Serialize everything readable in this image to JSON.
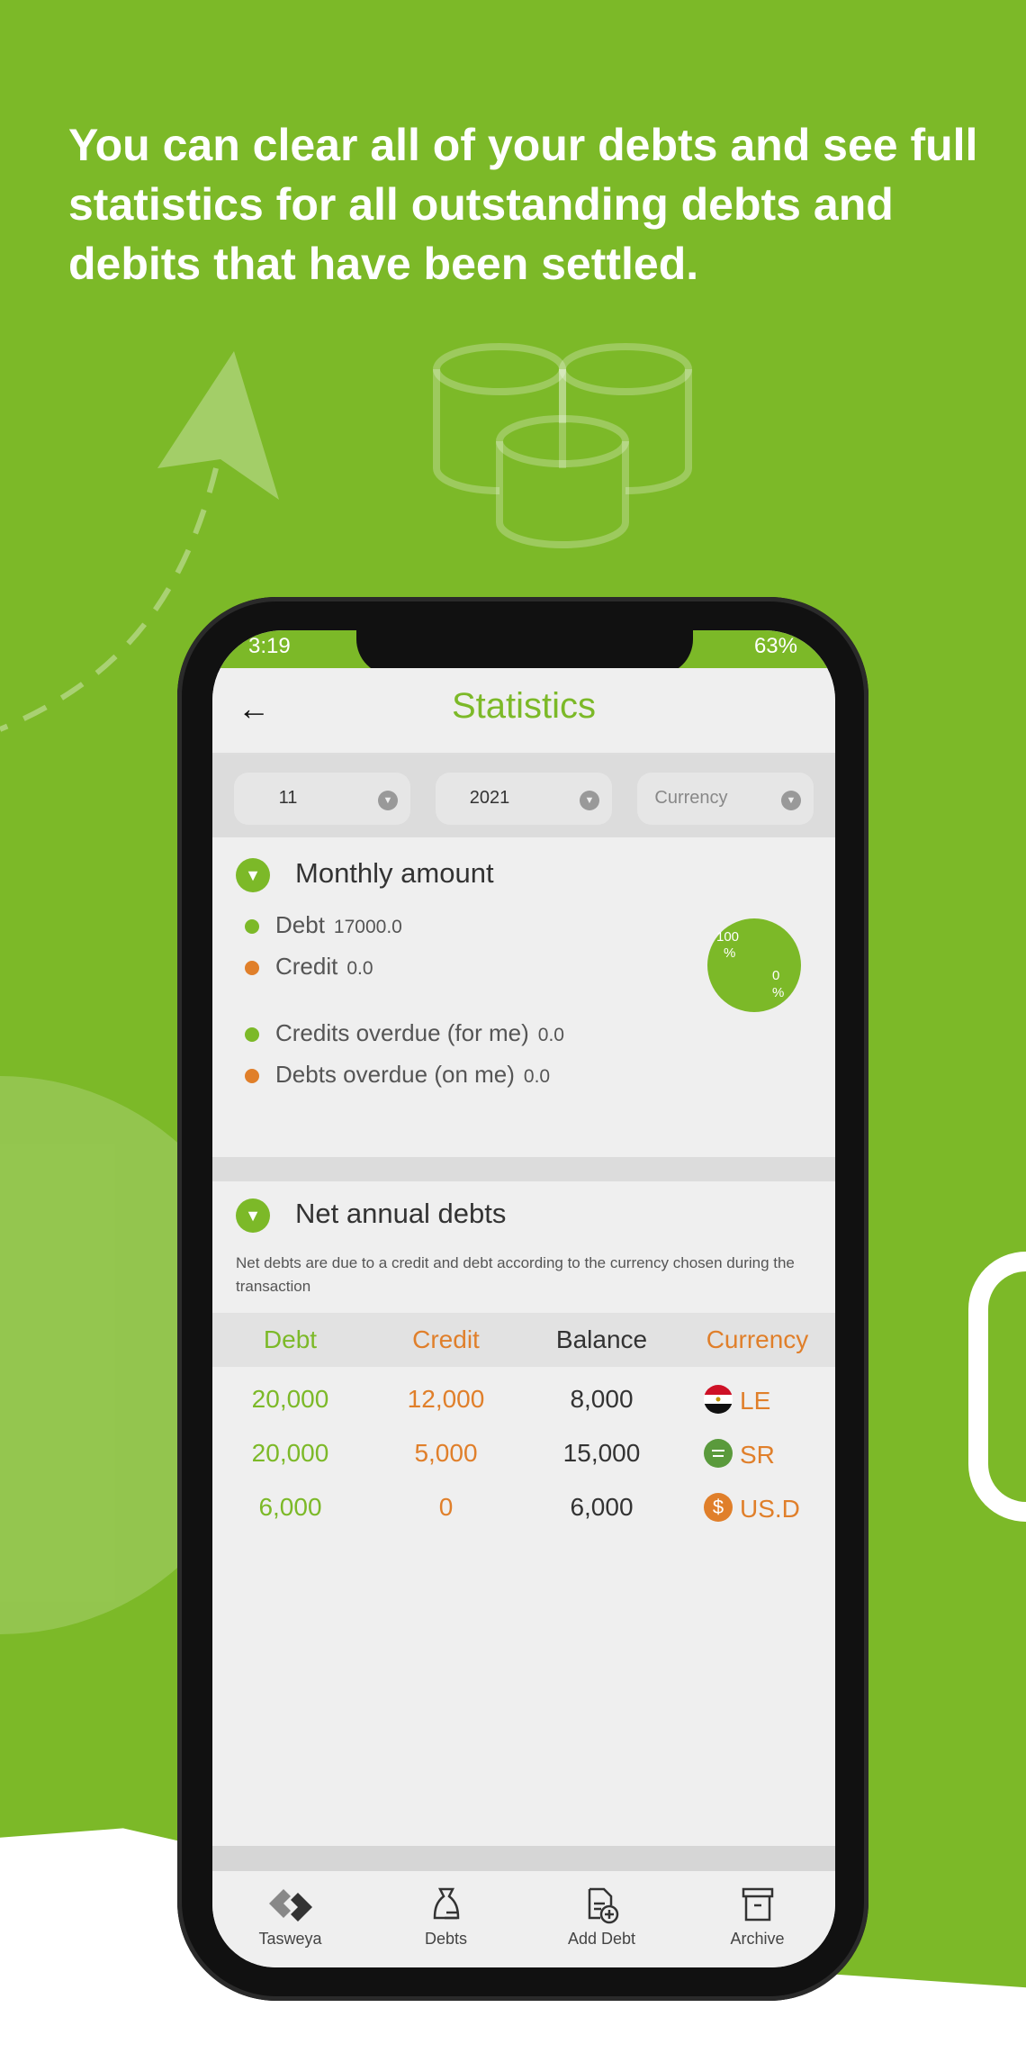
{
  "headline": "You can clear all of your debts and see full statistics for all outstanding debts and debits that have been settled.",
  "status": {
    "time": "3:19",
    "battery": "63%"
  },
  "header": {
    "title": "Statistics",
    "back_icon": "arrow-left-icon"
  },
  "filters": [
    {
      "value": "11"
    },
    {
      "value": "2021"
    },
    {
      "placeholder": "Currency"
    }
  ],
  "monthly": {
    "title": "Monthly amount",
    "items": [
      {
        "label": "Debt",
        "value": "17000.0",
        "color": "#7cb928"
      },
      {
        "label": "Credit",
        "value": "0.0",
        "color": "#e07f2a"
      },
      {
        "label": "Credits overdue (for me)",
        "value": "0.0",
        "color": "#7cb928"
      },
      {
        "label": "Debts overdue (on me)",
        "value": "0.0",
        "color": "#e07f2a"
      }
    ],
    "pie": {
      "debt_pct": "100",
      "debt_unit": "%",
      "credit_pct": "0",
      "credit_unit": "%"
    }
  },
  "annual": {
    "title": "Net annual debts",
    "description": "Net debts are due to a credit and debt according to the currency chosen during the transaction",
    "columns": [
      "Debt",
      "Credit",
      "Balance",
      "Currency"
    ],
    "rows": [
      {
        "debt": "20,000",
        "credit": "12,000",
        "balance": "8,000",
        "currency": "LE",
        "icon": "egypt-flag-icon"
      },
      {
        "debt": "20,000",
        "credit": "5,000",
        "balance": "15,000",
        "currency": "SR",
        "icon": "saudi-flag-icon"
      },
      {
        "debt": "6,000",
        "credit": "0",
        "balance": "6,000",
        "currency": "US.D",
        "icon": "dollar-icon"
      }
    ]
  },
  "nav": [
    {
      "label": "Tasweya"
    },
    {
      "label": "Debts"
    },
    {
      "label": "Add Debt"
    },
    {
      "label": "Archive"
    }
  ],
  "colors": {
    "green": "#7cb928",
    "orange": "#e07f2a"
  }
}
